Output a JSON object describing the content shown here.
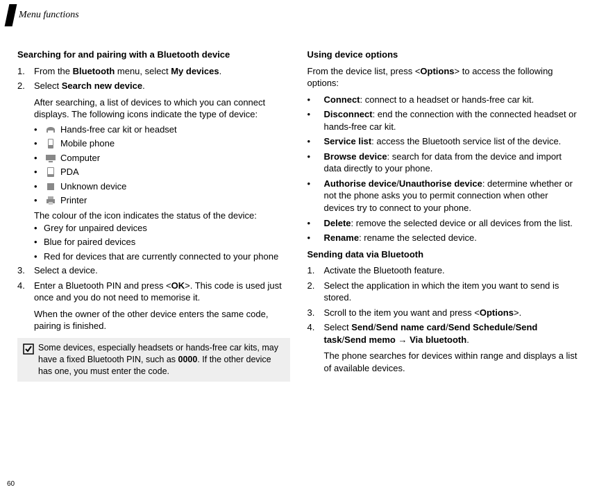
{
  "header": {
    "title": "Menu functions"
  },
  "page_number": "60",
  "left": {
    "h1": "Searching for and pairing with a Bluetooth device",
    "step1_pre": "From the ",
    "step1_b1": "Bluetooth",
    "step1_mid": " menu, select ",
    "step1_b2": "My devices",
    "step1_post": ".",
    "step2_pre": "Select ",
    "step2_b": "Search new device",
    "step2_post": ".",
    "step2_para": "After searching, a list of devices to which you can connect displays. The following icons indicate the type of device:",
    "icon_items": [
      "Hands-free car kit or headset",
      "Mobile phone",
      "Computer",
      "PDA",
      "Unknown device",
      "Printer"
    ],
    "color_intro": "The colour of the icon indicates the status of the device:",
    "colors": [
      "Grey for unpaired devices",
      "Blue for paired devices",
      "Red for devices that are currently connected to your phone"
    ],
    "step3": "Select a device.",
    "step4_pre": "Enter a Bluetooth PIN and press <",
    "step4_b": "OK",
    "step4_post": ">. This code is used just once and you do not need to memorise it.",
    "step4_para": "When the owner of the other device enters the same code, pairing is finished.",
    "note_pre": "Some devices, especially headsets or hands-free car kits, may have a fixed Bluetooth PIN, such as ",
    "note_b": "0000",
    "note_post": ". If the other device has one, you must enter the code."
  },
  "right": {
    "h1": "Using device options",
    "intro_pre": "From the device list, press <",
    "intro_b": "Options",
    "intro_post": "> to access the following options:",
    "opt_connect_b": "Connect",
    "opt_connect": ": connect to a headset or hands-free car kit.",
    "opt_disconnect_b": "Disconnect",
    "opt_disconnect": ": end the connection with the connected headset or hands-free car kit.",
    "opt_service_b": "Service list",
    "opt_service": ": access the Bluetooth service list of the device.",
    "opt_browse_b": "Browse device",
    "opt_browse": ": search for data from the device and import data directly to your phone.",
    "opt_auth_b": "Authorise device",
    "opt_auth_sep": "/",
    "opt_unauth_b": "Unauthorise device",
    "opt_auth": ": determine whether or not the phone asks you to permit connection when other devices try to connect to your phone.",
    "opt_delete_b": "Delete",
    "opt_delete": ": remove the selected device or all devices from the list.",
    "opt_rename_b": "Rename",
    "opt_rename": ": rename the selected device.",
    "h2": "Sending data via Bluetooth",
    "s1": "Activate the Bluetooth feature.",
    "s2": "Select the application in which the item you want to send is stored.",
    "s3_pre": "Scroll to the item you want and press <",
    "s3_b": "Options",
    "s3_post": ">.",
    "s4_pre": "Select ",
    "s4_b1": "Send",
    "s4_sep": "/",
    "s4_b2": "Send name card",
    "s4_b3": "Send Schedule",
    "s4_b4": "Send task",
    "s4_b5": "Send memo",
    "s4_arrow": " → ",
    "s4_b6": "Via bluetooth",
    "s4_post": ".",
    "s4_para": "The phone searches for devices within range and displays a list of available devices."
  }
}
